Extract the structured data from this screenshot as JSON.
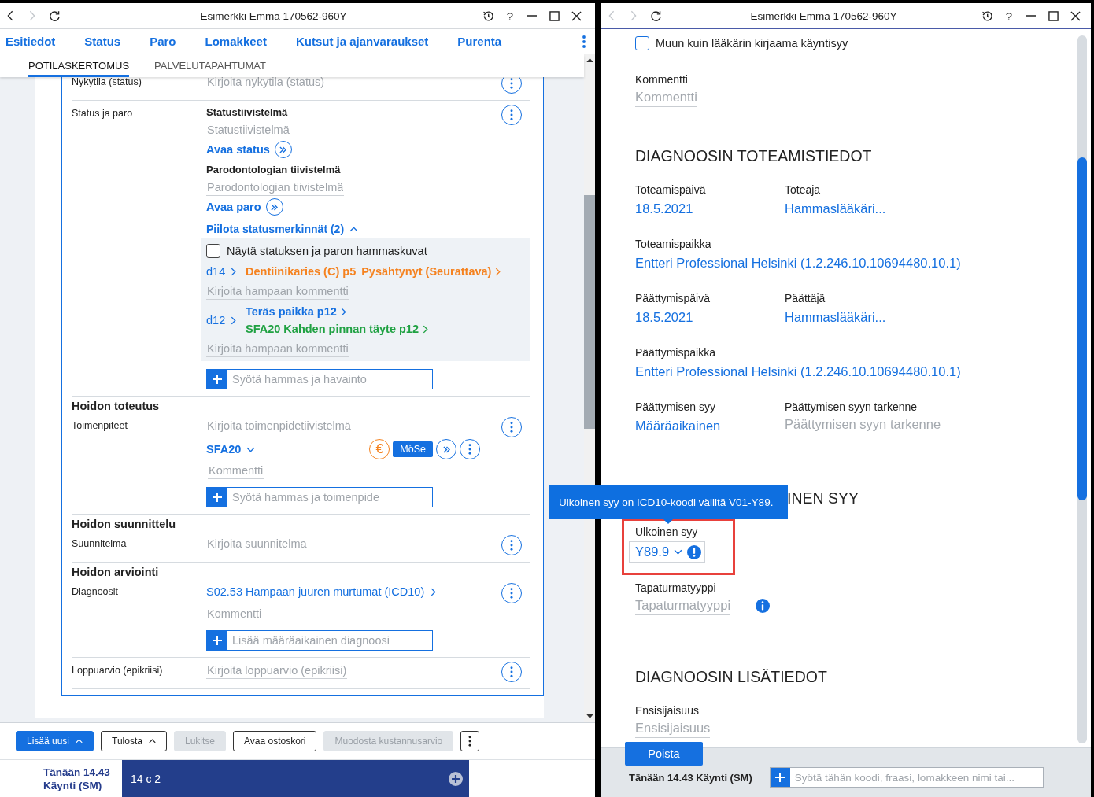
{
  "left_window": {
    "title_bar": {
      "title": "Esimerkki Emma 170562-960Y",
      "back_disabled": false,
      "forward_disabled": true,
      "help": "?"
    },
    "nav": [
      {
        "label": "Esitiedot"
      },
      {
        "label": "Status"
      },
      {
        "label": "Paro"
      },
      {
        "label": "Lomakkeet"
      },
      {
        "label": "Kutsut ja ajanvaraukset"
      },
      {
        "label": "Purenta"
      }
    ],
    "tabs": [
      {
        "label": "POTILASKERTOMUS",
        "selected": true
      },
      {
        "label": "PALVELUTAPAHTUMAT",
        "selected": false
      }
    ],
    "record": [
      {
        "label": "Nykytila (status)",
        "items": [
          {
            "kind": "field",
            "placeholder": "Kirjoita nykytila (status)"
          }
        ]
      },
      {
        "label": "Status ja paro",
        "items": [
          {
            "kind": "subheading",
            "text": "Statustiivistelmä"
          },
          {
            "kind": "field",
            "placeholder": "Statustiivistelmä"
          },
          {
            "kind": "link",
            "text": "Avaa status"
          },
          {
            "kind": "subheading",
            "text": "Parodontologian tiivistelmä"
          },
          {
            "kind": "field",
            "placeholder": "Parodontologian tiivistelmä"
          },
          {
            "kind": "link",
            "text": "Avaa paro"
          },
          {
            "kind": "toggle",
            "text": "Piilota statusmerkinnät (2)",
            "expanded": true
          },
          {
            "kind": "status_box",
            "checkbox": {
              "label": "Näytä statuksen ja paron hammaskuvat",
              "checked": false
            },
            "teeth": [
              {
                "tooth": "d14",
                "findings": [
                  {
                    "text": "Dentiinikaries (C) p5",
                    "note": "Pysähtynyt (Seurattava)",
                    "color": "#f5821f"
                  }
                ],
                "comment_placeholder": "Kirjoita hampaan kommentti"
              },
              {
                "tooth": "d12",
                "findings": [
                  {
                    "text": "Teräs paikka p12",
                    "color": "#1570e0"
                  },
                  {
                    "text": "SFA20 Kahden pinnan täyte p12",
                    "color": "#1fa142"
                  }
                ],
                "comment_placeholder": "Kirjoita hampaan kommentti"
              }
            ]
          },
          {
            "kind": "add_field",
            "placeholder": "Syötä hammas ja havainto"
          }
        ]
      },
      {
        "section": "Hoidon toteutus",
        "label": "Toimenpiteet",
        "items": [
          {
            "kind": "field",
            "placeholder": "Kirjoita toimenpidetiivistelmä"
          },
          {
            "kind": "procedure",
            "code": "SFA20",
            "expanded": false,
            "price_symbol": "€",
            "badge": "MöSe",
            "comment_placeholder": "Kommentti"
          },
          {
            "kind": "add_field",
            "placeholder": "Syötä hammas ja toimenpide"
          }
        ]
      },
      {
        "section": "Hoidon suunnittelu",
        "label": "Suunnitelma",
        "items": [
          {
            "kind": "field",
            "placeholder": "Kirjoita suunnitelma"
          }
        ]
      },
      {
        "section": "Hoidon arviointi",
        "label": "Diagnoosit",
        "items": [
          {
            "kind": "item_link",
            "text": "S02.53 Hampaan juuren murtumat (ICD10)"
          },
          {
            "kind": "field",
            "placeholder": "Kommentti"
          },
          {
            "kind": "add_field",
            "placeholder": "Lisää määräaikainen diagnoosi"
          }
        ]
      },
      {
        "label": "Loppuarvio (epikriisi)",
        "items": [
          {
            "kind": "field",
            "placeholder": "Kirjoita loppuarvio (epikriisi)"
          }
        ]
      }
    ],
    "toolbar": [
      {
        "label": "Lisää uusi",
        "kind": "primary",
        "menu": true,
        "disabled": false
      },
      {
        "label": "Tulosta",
        "kind": "outline",
        "menu": true,
        "disabled": false
      },
      {
        "label": "Lukitse",
        "kind": "outline",
        "menu": false,
        "disabled": true
      },
      {
        "label": "Avaa ostoskori",
        "kind": "outline",
        "menu": false,
        "disabled": false
      },
      {
        "label": "Muodosta kustannusarvio",
        "kind": "outline",
        "menu": false,
        "disabled": true
      }
    ],
    "status_bar": {
      "time": "Tänään 14.43",
      "visit": "Käynti (SM)",
      "tab": "14 c 2"
    }
  },
  "right_window": {
    "title_bar": {
      "title": "Esimerkki Emma 170562-960Y",
      "back_disabled": true,
      "forward_disabled": true,
      "help": "?"
    },
    "form": [
      {
        "kind": "checkbox",
        "label": "Muun kuin lääkärin kirjaama käyntisyy",
        "checked": false
      },
      {
        "kind": "fields",
        "fields": [
          {
            "label": "Kommentti",
            "placeholder": "Kommentti"
          }
        ]
      },
      {
        "kind": "heading",
        "text": "DIAGNOOSIN TOTEAMISTIEDOT"
      },
      {
        "kind": "fields",
        "fields": [
          {
            "label": "Toteamispäivä",
            "value": "18.5.2021"
          },
          {
            "label": "Toteaja",
            "value": "Hammaslääkäri..."
          }
        ]
      },
      {
        "kind": "fields",
        "fields": [
          {
            "label": "Toteamispaikka",
            "value": "Entteri Professional Helsinki (1.2.246.10.10694480.10.1)"
          }
        ]
      },
      {
        "kind": "fields",
        "fields": [
          {
            "label": "Päättymispäivä",
            "value": "18.5.2021"
          },
          {
            "label": "Päättäjä",
            "value": "Hammaslääkäri..."
          }
        ]
      },
      {
        "kind": "fields",
        "fields": [
          {
            "label": "Päättymispaikka",
            "value": "Entteri Professional Helsinki (1.2.246.10.10694480.10.1)"
          }
        ]
      },
      {
        "kind": "fields",
        "fields": [
          {
            "label": "Päättymisen syy",
            "value": "Määräaikainen"
          },
          {
            "label": "Päättymisen syyn tarkenne",
            "placeholder": "Päättymisen syyn tarkenne"
          }
        ]
      },
      {
        "kind": "heading",
        "text": "INEN SYY",
        "tooltip": "Ulkoinen syy on ICD10-koodi väliltä V01-Y89."
      },
      {
        "kind": "fields",
        "fields": [
          {
            "label": "Ulkoinen syy",
            "select": "Y89.9",
            "invalid": true,
            "highlighted": true
          }
        ]
      },
      {
        "kind": "fields",
        "fields": [
          {
            "label": "Tapaturmatyyppi",
            "placeholder": "Tapaturmatyyppi",
            "info": true
          }
        ]
      },
      {
        "kind": "heading",
        "text": "DIAGNOOSIN LISÄTIEDOT"
      },
      {
        "kind": "fields",
        "fields": [
          {
            "label": "Ensisijaisuus",
            "placeholder": "Ensisijaisuus"
          }
        ]
      }
    ],
    "delete_button": "Poista",
    "status_text": "Tänään 14.43 Käynti (SM)",
    "command": {
      "placeholder": "Syötä tähän koodi, fraasi, lomakkeen nimi tai..."
    }
  }
}
